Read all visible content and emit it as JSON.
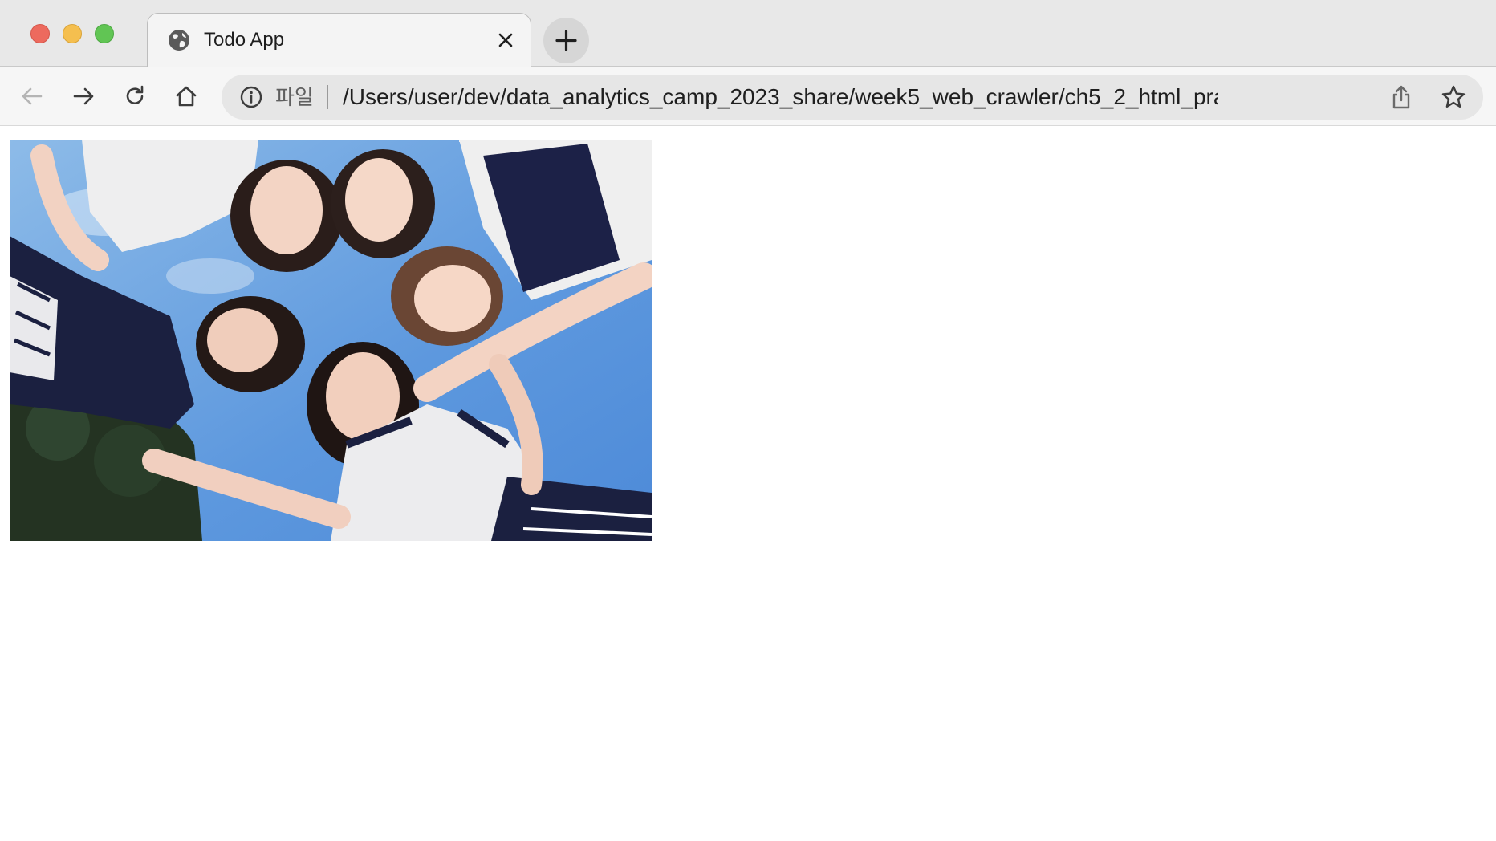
{
  "browser": {
    "tab": {
      "title": "Todo App",
      "favicon": "globe-icon",
      "close_icon": "close-icon"
    },
    "new_tab_icon": "plus-icon",
    "nav": {
      "back_icon": "arrow-left-icon",
      "forward_icon": "arrow-right-icon",
      "reload_icon": "reload-icon",
      "home_icon": "home-icon"
    },
    "address_bar": {
      "info_icon": "info-icon",
      "scheme_label": "파일",
      "url": "/Users/user/dev/data_analytics_camp_2023_share/week5_web_crawler/ch5_2_html_practices...",
      "share_icon": "share-icon",
      "bookmark_icon": "star-icon"
    }
  },
  "page": {
    "image": {
      "subject": "photo"
    }
  },
  "colors": {
    "traffic_close": "#ed6a5e",
    "traffic_minimize": "#f5bf4f",
    "traffic_maximize": "#61c554",
    "sky": "#6fa3dc",
    "navy": "#1b2040"
  }
}
